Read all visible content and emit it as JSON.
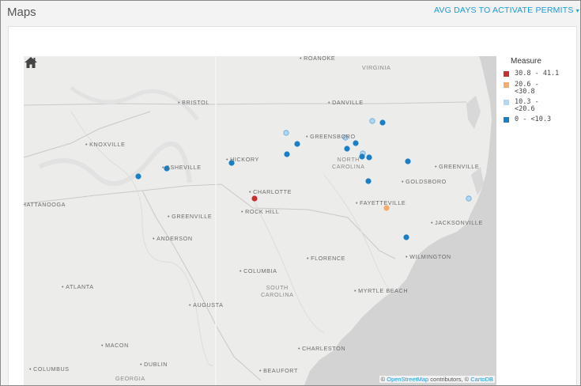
{
  "header": {
    "title": "Maps",
    "measure_label": "AVG DAYS TO ACTIVATE PERMITS",
    "measure_caret": "▾"
  },
  "legend": {
    "title": "Measure",
    "items": [
      {
        "label": "30.8 - 41.1",
        "color": "#c9302c"
      },
      {
        "label": "20.6 - <30.8",
        "color": "#f2ac6b"
      },
      {
        "label": "10.3 - <20.6",
        "color": "#b3d7f2"
      },
      {
        "label": "0 - <10.3",
        "color": "#1a7fc4"
      }
    ]
  },
  "map": {
    "home_icon": "home-icon",
    "cities": [
      {
        "name": "ROANOKE"
      },
      {
        "name": "BRISTOL"
      },
      {
        "name": "DANVILLE"
      },
      {
        "name": "KNOXVILLE"
      },
      {
        "name": "GREENSBORO"
      },
      {
        "name": "HICKORY"
      },
      {
        "name": "ASHEVILLE"
      },
      {
        "name": "GREENVILLE"
      },
      {
        "name": "GOLDSBORO"
      },
      {
        "name": "CHARLOTTE"
      },
      {
        "name": "CHATTANOOGA"
      },
      {
        "name": "FAYETTEVILLE"
      },
      {
        "name": "ROCK HILL"
      },
      {
        "name": "GREENVILLE"
      },
      {
        "name": "JACKSONVILLE"
      },
      {
        "name": "ANDERSON"
      },
      {
        "name": "FLORENCE"
      },
      {
        "name": "WILMINGTON"
      },
      {
        "name": "COLUMBIA"
      },
      {
        "name": "ATLANTA"
      },
      {
        "name": "MYRTLE BEACH"
      },
      {
        "name": "AUGUSTA"
      },
      {
        "name": "MACON"
      },
      {
        "name": "CHARLESTON"
      },
      {
        "name": "DUBLIN"
      },
      {
        "name": "COLUMBUS"
      },
      {
        "name": "BEAUFORT"
      }
    ],
    "regions": [
      {
        "name": "VIRGINIA"
      },
      {
        "name": "NORTH\nCAROLINA"
      },
      {
        "name": "SOUTH\nCAROLINA"
      },
      {
        "name": "GEORGIA"
      }
    ],
    "attribution": {
      "prefix": "© ",
      "osm": "OpenStreetMap",
      "middle": " contributors, © ",
      "carto": "CartoDB"
    }
  },
  "chart_data": {
    "type": "scatter",
    "legend_title": "Measure",
    "bins": [
      "30.8 - 41.1",
      "20.6 - <30.8",
      "10.3 - <20.6",
      "0 - <10.3"
    ],
    "points": [
      {
        "bin": "0 - <10.3"
      },
      {
        "bin": "0 - <10.3"
      },
      {
        "bin": "0 - <10.3"
      },
      {
        "bin": "10.3 - <20.6"
      },
      {
        "bin": "0 - <10.3"
      },
      {
        "bin": "0 - <10.3"
      },
      {
        "bin": "10.3 - <20.6"
      },
      {
        "bin": "0 - <10.3"
      },
      {
        "bin": "10.3 - <20.6"
      },
      {
        "bin": "0 - <10.3"
      },
      {
        "bin": "0 - <10.3"
      },
      {
        "bin": "10.3 - <20.6"
      },
      {
        "bin": "0 - <10.3"
      },
      {
        "bin": "0 - <10.3"
      },
      {
        "bin": "30.8 - 41.1"
      },
      {
        "bin": "0 - <10.3"
      },
      {
        "bin": "20.6 - <30.8"
      },
      {
        "bin": "10.3 - <20.6"
      },
      {
        "bin": "0 - <10.3"
      },
      {
        "bin": "0 - <10.3"
      }
    ]
  }
}
